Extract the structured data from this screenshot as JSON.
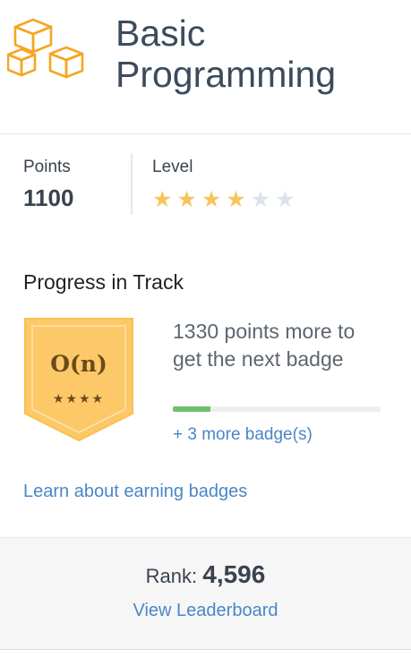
{
  "track": {
    "title": "Basic Programming",
    "logo_icon": "cubes-icon",
    "logo_color": "#f5a623"
  },
  "stats": {
    "points_label": "Points",
    "points_value": "1100",
    "level_label": "Level",
    "level_stars_filled": 4,
    "level_stars_total": 6,
    "star_filled_color": "#f8c45c",
    "star_empty_color": "#dde3ea"
  },
  "progress": {
    "title": "Progress in Track",
    "badge": {
      "label": "O(n)",
      "stars": "★★★★",
      "color": "#fdc968"
    },
    "next_text": "1330 points more to get the next badge",
    "fraction": 0.18,
    "more_badges": "+ 3 more badge(s)"
  },
  "learn_link": "Learn about earning badges",
  "footer": {
    "rank_label": "Rank: ",
    "rank_value": "4,596",
    "leaderboard_link": "View Leaderboard"
  }
}
